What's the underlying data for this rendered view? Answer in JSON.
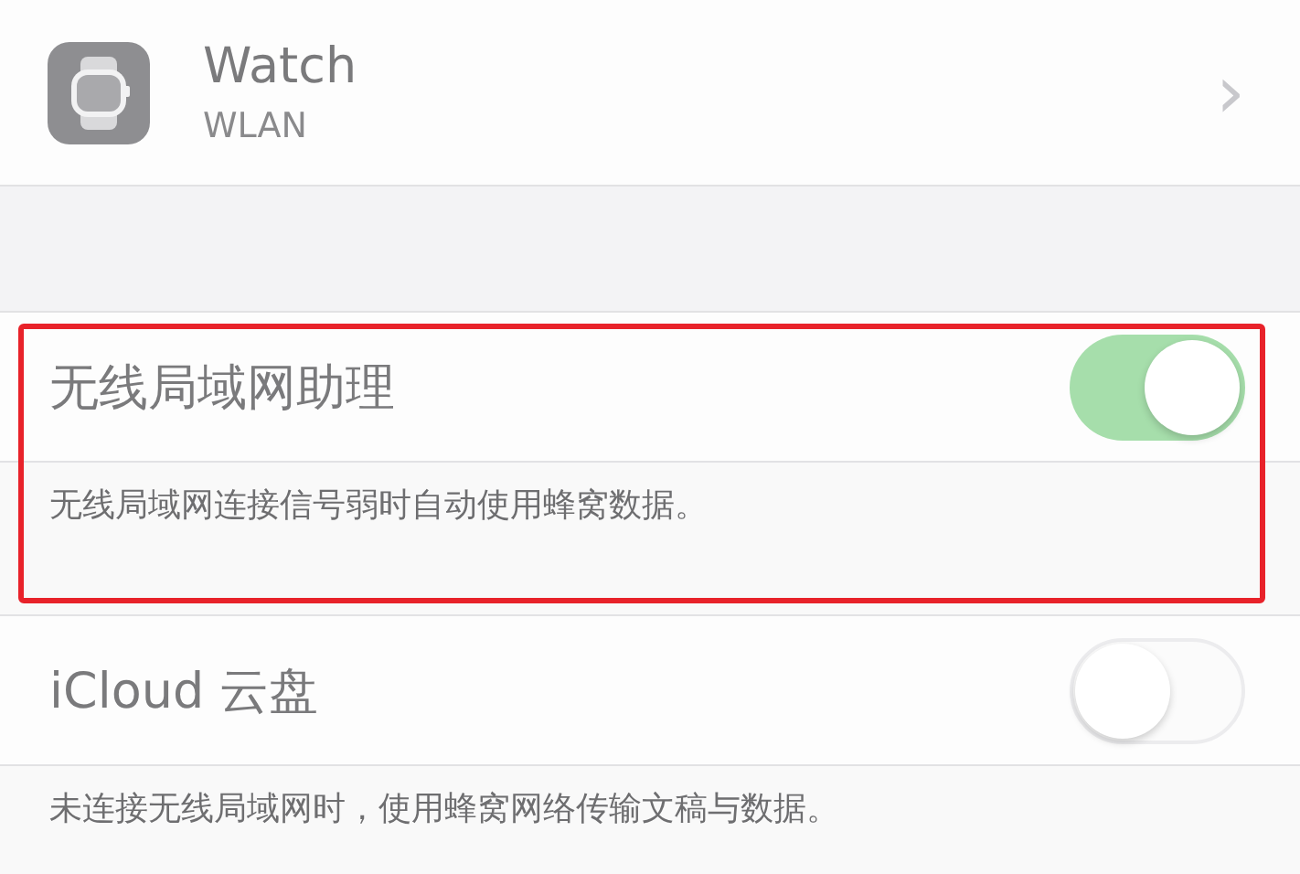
{
  "app_row": {
    "title": "Watch",
    "subtitle": "WLAN",
    "chevron": "›"
  },
  "sections": [
    {
      "label": "无线局域网助理",
      "on": true,
      "highlighted": true,
      "footer": "无线局域网连接信号弱时自动使用蜂窝数据。"
    },
    {
      "label": "iCloud 云盘",
      "on": false,
      "highlighted": false,
      "footer": "未连接无线局域网时，使用蜂窝网络传输文稿与数据。"
    }
  ]
}
